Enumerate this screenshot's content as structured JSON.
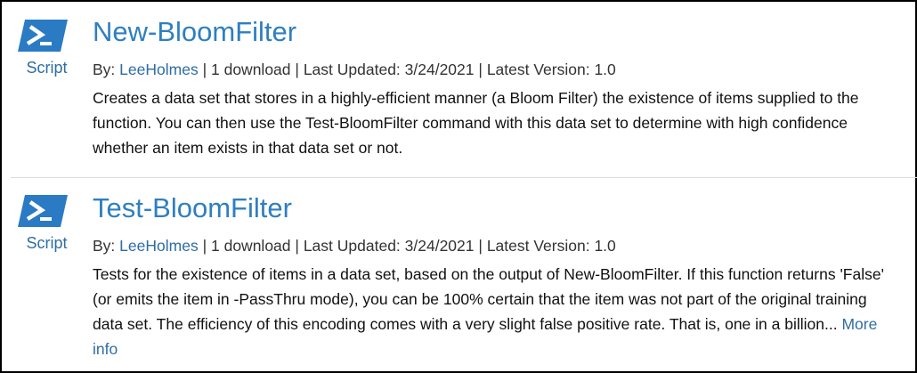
{
  "results": [
    {
      "title": "New-BloomFilter",
      "type_label": "Script",
      "icon": "powershell-icon",
      "by_label": "By:",
      "author": "LeeHolmes",
      "sep1": "|",
      "downloads": "1 download",
      "sep2": "|",
      "last_updated": "Last Updated: 3/24/2021",
      "sep3": "|",
      "latest_version": "Latest Version: 1.0",
      "description": "Creates a data set that stores in a highly-efficient manner (a Bloom Filter) the existence of items supplied to the function. You can then use the Test-BloomFilter command with this data set to determine with high confidence whether an item exists in that data set or not."
    },
    {
      "title": "Test-BloomFilter",
      "type_label": "Script",
      "icon": "powershell-icon",
      "by_label": "By:",
      "author": "LeeHolmes",
      "sep1": "|",
      "downloads": "1 download",
      "sep2": "|",
      "last_updated": "Last Updated: 3/24/2021",
      "sep3": "|",
      "latest_version": "Latest Version: 1.0",
      "description": "Tests for the existence of items in a data set, based on the output of New-BloomFilter. If this function returns 'False' (or emits the item in -PassThru mode), you can be 100% certain that the item was not part of the original training data set. The efficiency of this encoding comes with a very slight false positive rate. That is, one in a billion...",
      "more_info": "More info"
    }
  ],
  "colors": {
    "link": "#2e6da4",
    "title": "#2e7fc0",
    "icon_bg": "#2a7bc4",
    "border": "#000000"
  }
}
